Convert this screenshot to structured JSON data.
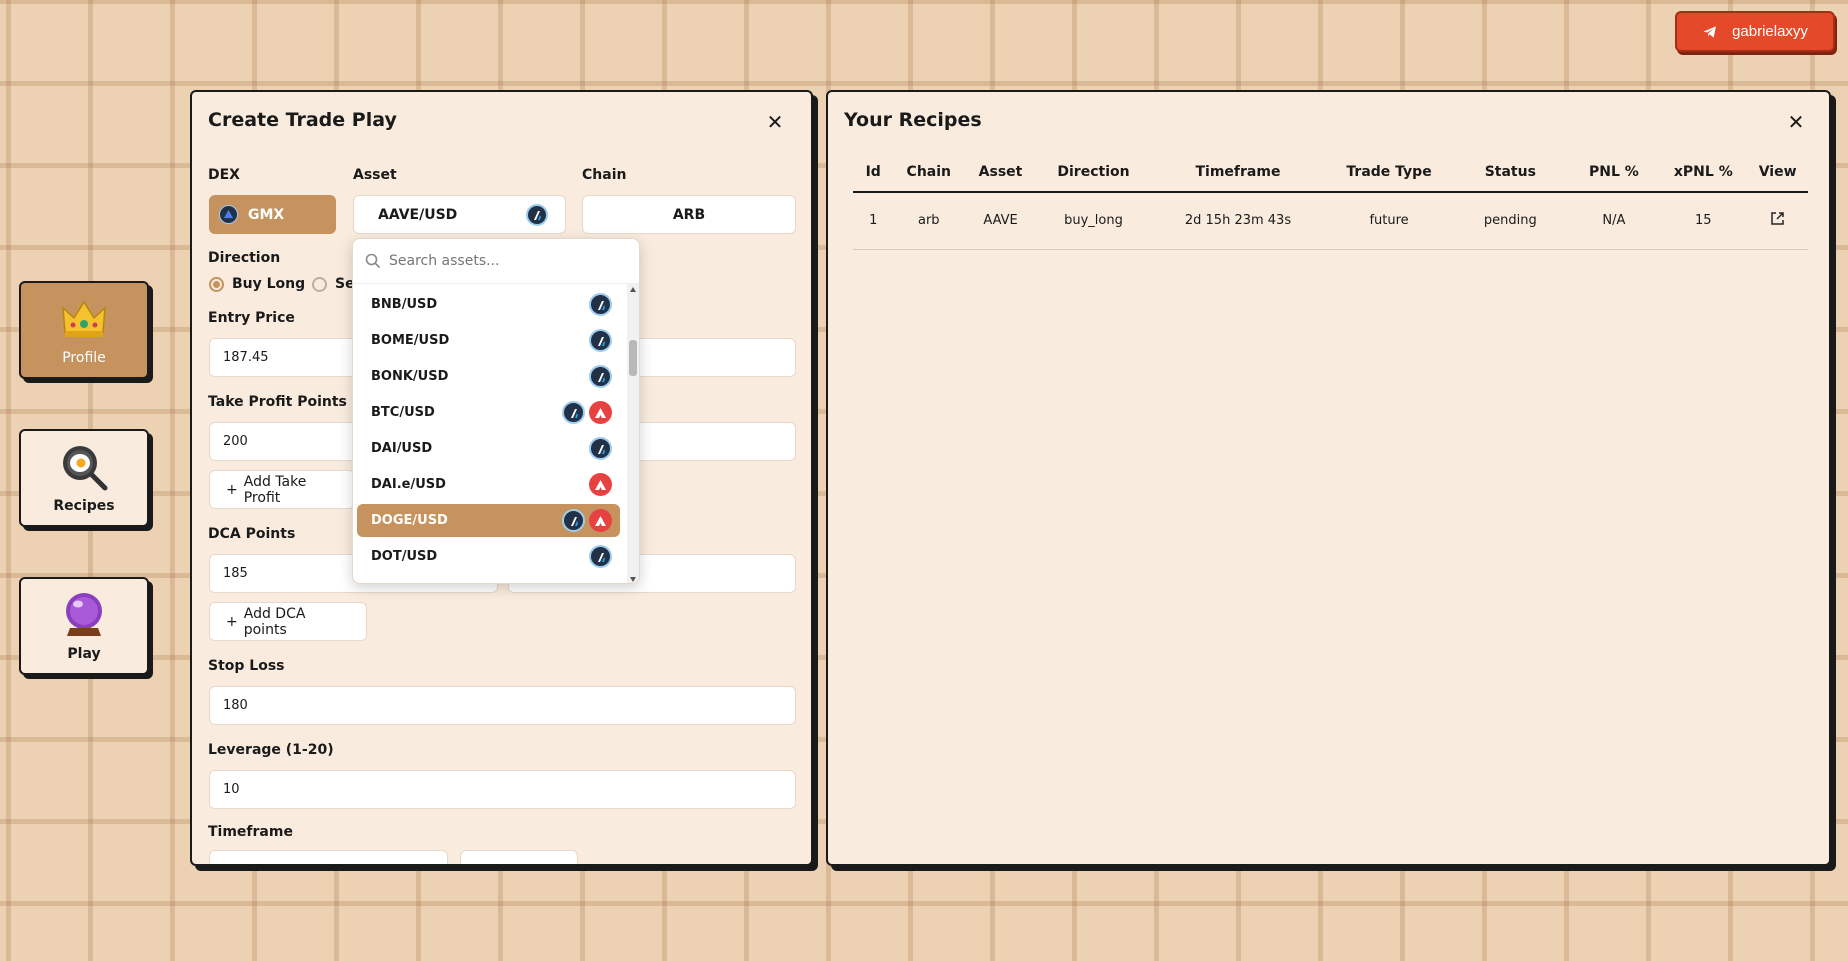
{
  "telegram": {
    "user": "gabrielaxyy"
  },
  "sidebar": {
    "items": [
      {
        "label": "Profile",
        "icon": "crown-icon"
      },
      {
        "label": "Recipes",
        "icon": "frying-pan-icon"
      },
      {
        "label": "Play",
        "icon": "crystal-ball-icon"
      }
    ]
  },
  "create_panel": {
    "title": "Create Trade Play",
    "dex_label": "DEX",
    "dex_value": "GMX",
    "asset_label": "Asset",
    "asset_value": "AAVE/USD",
    "chain_label": "Chain",
    "chain_value": "ARB",
    "direction_label": "Direction",
    "direction_buy": "Buy Long",
    "direction_sell": "Sel",
    "entry_label": "Entry Price",
    "entry_value": "187.45",
    "tp_label": "Take Profit Points",
    "tp_value": "200",
    "add_tp": "Add Take Profit",
    "dca_label": "DCA Points",
    "dca_value": "185",
    "add_dca": "Add DCA points",
    "sl_label": "Stop Loss",
    "sl_value": "180",
    "lev_label": "Leverage (1-20)",
    "lev_value": "10",
    "tf_label": "Timeframe"
  },
  "asset_dropdown": {
    "search_placeholder": "Search assets...",
    "items": [
      {
        "label": "BNB/USD",
        "chains": [
          "arbitrum"
        ]
      },
      {
        "label": "BOME/USD",
        "chains": [
          "arbitrum"
        ]
      },
      {
        "label": "BONK/USD",
        "chains": [
          "arbitrum"
        ]
      },
      {
        "label": "BTC/USD",
        "chains": [
          "arbitrum",
          "avalanche"
        ]
      },
      {
        "label": "DAI/USD",
        "chains": [
          "arbitrum"
        ]
      },
      {
        "label": "DAI.e/USD",
        "chains": [
          "avalanche"
        ]
      },
      {
        "label": "DOGE/USD",
        "chains": [
          "arbitrum",
          "avalanche"
        ],
        "selected": true
      },
      {
        "label": "DOT/USD",
        "chains": [
          "arbitrum"
        ]
      }
    ]
  },
  "recipes_panel": {
    "title": "Your Recipes",
    "columns": [
      "Id",
      "Chain",
      "Asset",
      "Direction",
      "Timeframe",
      "Trade Type",
      "Status",
      "PNL %",
      "xPNL %",
      "View"
    ],
    "rows": [
      {
        "id": "1",
        "chain": "arb",
        "asset": "AAVE",
        "direction": "buy_long",
        "timeframe": "2d 15h 23m 43s",
        "trade_type": "future",
        "status": "pending",
        "pnl": "N/A",
        "xpnl": "15"
      }
    ]
  },
  "colors": {
    "accent": "#c6935f",
    "telegram_button": "#e4492a",
    "panel_bg": "#f9ecdf"
  }
}
